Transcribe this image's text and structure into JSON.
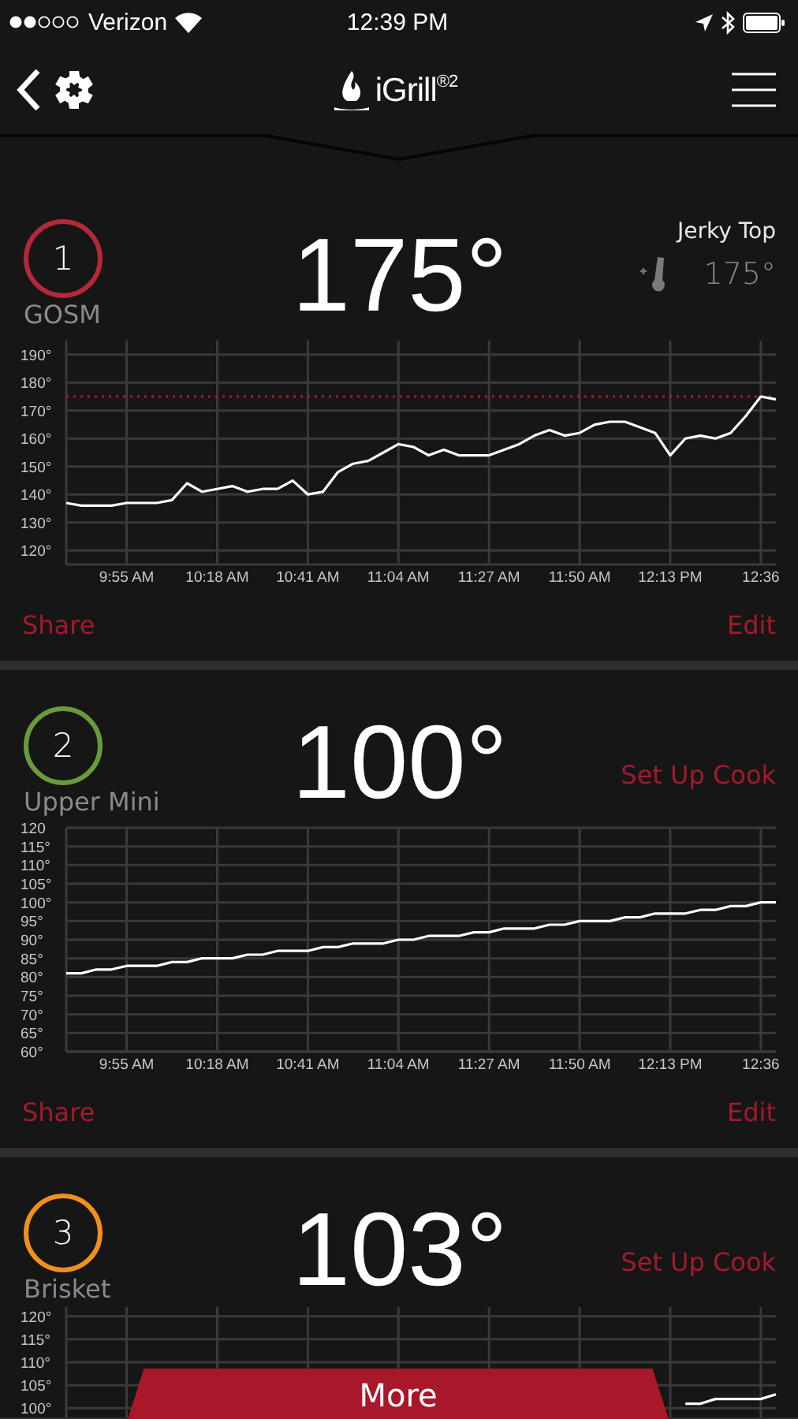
{
  "status_bar": {
    "carrier": "Verizon",
    "time": "12:39 PM"
  },
  "nav": {
    "logo_text": "iGrill$^{®2}$"
  },
  "probes": [
    {
      "number": "1",
      "color": "#b5283a",
      "name": "GOSM",
      "temperature": "175°",
      "right": {
        "kind": "target",
        "label": "Jerky Top",
        "temperature": "175°"
      },
      "footer": {
        "share": "Share",
        "edit": "Edit"
      },
      "chart_data": {
        "type": "line",
        "ylim": [
          115,
          195
        ],
        "yticks": [
          {
            "value": 120,
            "label": "120°"
          },
          {
            "value": 130,
            "label": "130°"
          },
          {
            "value": 140,
            "label": "140°"
          },
          {
            "value": 150,
            "label": "150°"
          },
          {
            "value": 160,
            "label": "160°"
          },
          {
            "value": 170,
            "label": "170°"
          },
          {
            "value": 180,
            "label": "180°"
          },
          {
            "value": 190,
            "label": "190°"
          }
        ],
        "categories": [
          null,
          null,
          null,
          null,
          "9:55 AM",
          null,
          null,
          null,
          null,
          null,
          "10:18 AM",
          null,
          null,
          null,
          null,
          null,
          "10:41 AM",
          null,
          null,
          null,
          null,
          null,
          "11:04 AM",
          null,
          null,
          null,
          null,
          null,
          "11:27 AM",
          null,
          null,
          null,
          null,
          null,
          "11:50 AM",
          null,
          null,
          null,
          null,
          null,
          "12:13 PM",
          null,
          null,
          null,
          null,
          null,
          "12:36",
          null
        ],
        "series": [
          {
            "color": "#ffffff",
            "values": [
              137,
              136,
              136,
              136,
              137,
              137,
              137,
              138,
              144,
              141,
              142,
              143,
              141,
              142,
              142,
              145,
              140,
              141,
              148,
              151,
              152,
              155,
              158,
              157,
              154,
              156,
              154,
              154,
              154,
              156,
              158,
              161,
              163,
              161,
              162,
              165,
              166,
              166,
              164,
              162,
              154,
              160,
              161,
              160,
              162,
              168,
              175,
              174
            ]
          }
        ],
        "ref_lines": [
          {
            "axis": "y",
            "value": 175
          }
        ],
        "grid": true
      }
    },
    {
      "number": "2",
      "color": "#6a9a3a",
      "name": "Upper Mini",
      "temperature": "100°",
      "right": {
        "kind": "action",
        "label": "Set Up Cook"
      },
      "footer": {
        "share": "Share",
        "edit": "Edit"
      },
      "chart_data": {
        "type": "line",
        "ylim": [
          60,
          120
        ],
        "yticks": [
          {
            "value": 60,
            "label": "60°"
          },
          {
            "value": 65,
            "label": "65°"
          },
          {
            "value": 70,
            "label": "70°"
          },
          {
            "value": 75,
            "label": "75°"
          },
          {
            "value": 80,
            "label": "80°"
          },
          {
            "value": 85,
            "label": "85°"
          },
          {
            "value": 90,
            "label": "90°"
          },
          {
            "value": 95,
            "label": "95°"
          },
          {
            "value": 100,
            "label": "100°"
          },
          {
            "value": 105,
            "label": "105°"
          },
          {
            "value": 110,
            "label": "110°"
          },
          {
            "value": 115,
            "label": "115°"
          },
          {
            "value": 120,
            "label": "120"
          }
        ],
        "categories": [
          null,
          null,
          null,
          null,
          "9:55 AM",
          null,
          null,
          null,
          null,
          null,
          "10:18 AM",
          null,
          null,
          null,
          null,
          null,
          "10:41 AM",
          null,
          null,
          null,
          null,
          null,
          "11:04 AM",
          null,
          null,
          null,
          null,
          null,
          "11:27 AM",
          null,
          null,
          null,
          null,
          null,
          "11:50 AM",
          null,
          null,
          null,
          null,
          null,
          "12:13 PM",
          null,
          null,
          null,
          null,
          null,
          "12:36",
          null
        ],
        "grid": true,
        "series": [
          {
            "color": "#ffffff",
            "values": [
              81,
              81,
              82,
              82,
              83,
              83,
              83,
              84,
              84,
              85,
              85,
              85,
              86,
              86,
              87,
              87,
              87,
              88,
              88,
              89,
              89,
              89,
              90,
              90,
              91,
              91,
              91,
              92,
              92,
              93,
              93,
              93,
              94,
              94,
              95,
              95,
              95,
              96,
              96,
              97,
              97,
              97,
              98,
              98,
              99,
              99,
              100,
              100
            ]
          }
        ]
      }
    },
    {
      "number": "3",
      "color": "#f0901e",
      "name": "Brisket",
      "temperature": "103°",
      "right": {
        "kind": "action",
        "label": "Set Up Cook"
      },
      "chart_data": {
        "type": "line",
        "ylim": [
          98,
          122
        ],
        "yticks": [
          {
            "value": 100,
            "label": "100°"
          },
          {
            "value": 105,
            "label": "105°"
          },
          {
            "value": 110,
            "label": "110°"
          },
          {
            "value": 115,
            "label": "115°"
          },
          {
            "value": 120,
            "label": "120°"
          }
        ],
        "grid": true,
        "series": [
          {
            "color": "#ffffff",
            "values": [
              null,
              null,
              null,
              null,
              null,
              null,
              null,
              null,
              null,
              null,
              null,
              null,
              null,
              null,
              null,
              null,
              null,
              null,
              null,
              null,
              null,
              null,
              null,
              null,
              null,
              null,
              null,
              null,
              null,
              null,
              null,
              null,
              null,
              null,
              null,
              null,
              null,
              null,
              null,
              null,
              null,
              101,
              101,
              102,
              102,
              102,
              102,
              103
            ]
          }
        ]
      }
    }
  ],
  "more_button": {
    "label": "More"
  }
}
